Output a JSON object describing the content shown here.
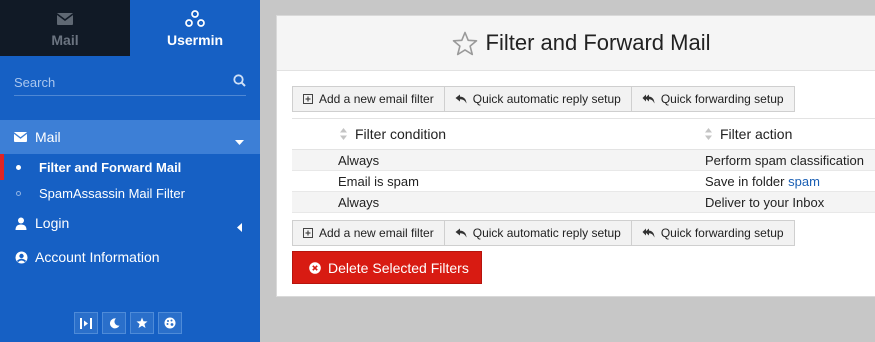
{
  "sidebar": {
    "tabs": [
      {
        "label": "Mail",
        "icon": "envelope-icon"
      },
      {
        "label": "Usermin",
        "icon": "usermin-logo-icon"
      }
    ],
    "search": {
      "placeholder": "Search",
      "icon": "search-icon"
    },
    "mail": {
      "label": "Mail",
      "icon": "envelope-icon"
    },
    "sub_items": [
      {
        "label": "Filter and Forward Mail",
        "active": true
      },
      {
        "label": "SpamAssassin Mail Filter",
        "active": false
      }
    ],
    "login": {
      "label": "Login",
      "icon": "key-icon"
    },
    "account": {
      "label": "Account Information",
      "icon": "user-circle-icon"
    },
    "bottom_icons": [
      "collapse-icon",
      "moon-icon",
      "star-icon",
      "palette-icon"
    ]
  },
  "main": {
    "title": "Filter and Forward Mail",
    "title_icon": "star-outline-icon",
    "buttons": {
      "add": "Add a new email filter",
      "reply": "Quick automatic reply setup",
      "forward": "Quick forwarding setup"
    },
    "table": {
      "headers": [
        "Filter condition",
        "Filter action"
      ],
      "rows": [
        {
          "condition": "Always",
          "action": "Perform spam classification",
          "link": ""
        },
        {
          "condition": "Email is spam",
          "action": "Save in folder ",
          "link": "spam"
        },
        {
          "condition": "Always",
          "action": "Deliver to your Inbox",
          "link": ""
        }
      ]
    },
    "delete_label": "Delete Selected Filters"
  },
  "colors": {
    "sidebar_bg": "#1660c4",
    "active_indicator": "#e02424",
    "delete_button": "#d81b12",
    "link": "#1a5fb4"
  }
}
